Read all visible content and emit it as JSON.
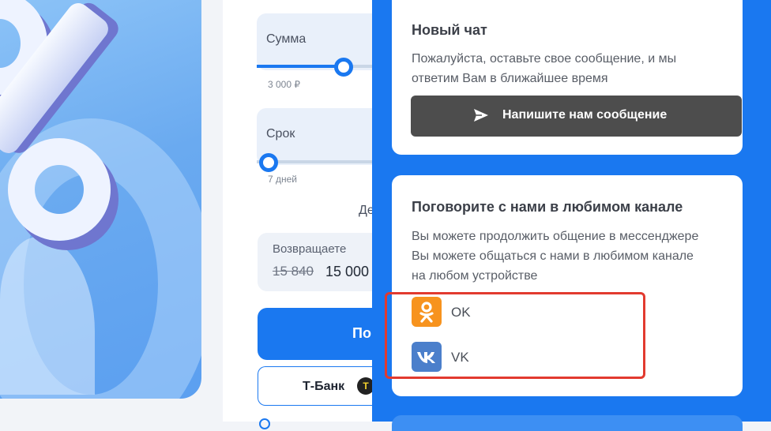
{
  "form": {
    "sum_label": "Сумма",
    "sum_hint": "3 000 ₽",
    "sum_progress": 0.68,
    "term_label": "Срок",
    "term_hint": "7 дней",
    "term_progress": 0.0,
    "period_text": "Де",
    "return_label": "Возвращаете",
    "return_old": "15 840",
    "return_new": "15 000",
    "cta_label": "По",
    "bank_name": "Т-Банк",
    "bank_logo_letter": "T"
  },
  "chat": {
    "new_chat_title": "Новый чат",
    "new_chat_text_line1": "Пожалуйста, оставьте свое сообщение, и мы",
    "new_chat_text_line2": "ответим Вам в ближайшее время",
    "send_button_label": "Напишите нам сообщение",
    "send_icon": "paper-plane-icon",
    "channels_title": "Поговорите с нами в любимом канале",
    "channels_text_line1": "Вы можете продолжить общение в мессенджере",
    "channels_text_line2": "Вы можете общаться с нами в любимом канале",
    "channels_text_line3": "на любом устройстве",
    "channels": [
      {
        "name": "OK",
        "icon": "odnoklassniki-icon",
        "color": "#f7931e"
      },
      {
        "name": "VK",
        "icon": "vk-icon",
        "color": "#4b7fcb"
      }
    ]
  },
  "colors": {
    "accent": "#1a78f0",
    "highlight": "#e23a2f",
    "send_button_bg": "#4d4d4d"
  }
}
